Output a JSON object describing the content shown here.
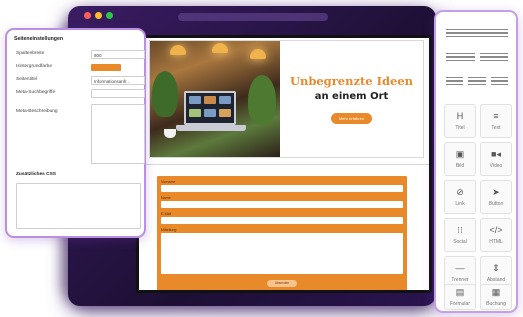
{
  "colors": {
    "accent": "#e8892a",
    "panel_border": "#c49ee6",
    "browser_dark": "#2a1450",
    "dot_red": "#ff5f57",
    "dot_yellow": "#febc2e",
    "dot_green": "#28c840"
  },
  "settings": {
    "heading": "Seiteneinstellungen",
    "fields": [
      {
        "label": "Spaltenbreite",
        "value": "800"
      },
      {
        "label": "Hintergrundfarbe",
        "color": "#e8892a"
      },
      {
        "label": "Seitentitel",
        "value": "Informationsanfr..."
      },
      {
        "label": "Meta-Suchbegriffe",
        "value": ""
      },
      {
        "label": "Meta-Beschreibung",
        "value": ""
      }
    ],
    "css_heading": "Zusätzliches CSS"
  },
  "hero": {
    "title": "Unbegrenzte Ideen",
    "subtitle": "an einem Ort",
    "button": "Mehr erfahren"
  },
  "form": {
    "labels": [
      "Vorname",
      "Name",
      "E-Mail",
      "Mitteilung"
    ],
    "submit": "Absenden"
  },
  "palette": {
    "layouts": [
      1,
      2,
      3
    ],
    "widgets": [
      {
        "icon": "H",
        "icon_name": "heading-icon",
        "label": "Titel"
      },
      {
        "icon": "≡",
        "icon_name": "text-icon",
        "label": "Text"
      },
      {
        "icon": "▣",
        "icon_name": "image-icon",
        "label": "Bild"
      },
      {
        "icon": "■◂",
        "icon_name": "video-icon",
        "label": "Video"
      },
      {
        "icon": "⊘",
        "icon_name": "link-icon",
        "label": "Link"
      },
      {
        "icon": "➤",
        "icon_name": "cursor-icon",
        "label": "Button"
      },
      {
        "icon": "⁝⁝",
        "icon_name": "share-icon",
        "label": "Social"
      },
      {
        "icon": "</>",
        "icon_name": "code-icon",
        "label": "HTML"
      },
      {
        "icon": "—",
        "icon_name": "divider-icon",
        "label": "Trenner"
      },
      {
        "icon": "⇕",
        "icon_name": "spacer-icon",
        "label": "Abstand"
      },
      {
        "icon": "▤",
        "icon_name": "form-icon",
        "label": "Formular"
      },
      {
        "icon": "▦",
        "icon_name": "calendar-icon",
        "label": "Buchung"
      }
    ]
  }
}
